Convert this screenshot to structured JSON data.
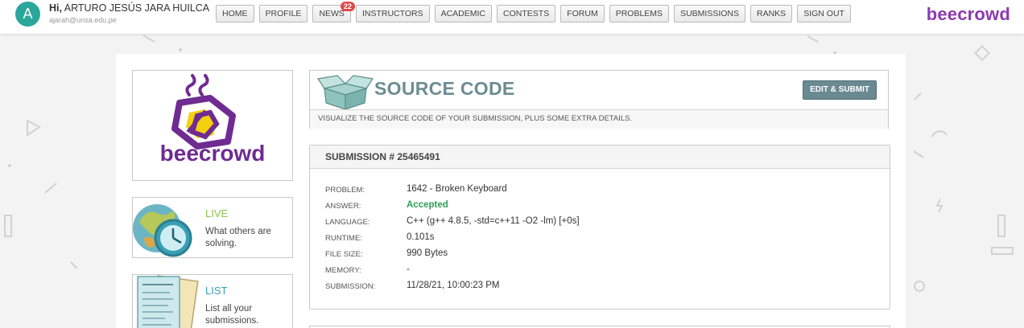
{
  "user": {
    "avatar_letter": "A",
    "greeting": "Hi,",
    "name": "ARTURO JESÚS JARA HUILCA",
    "email": "ajarah@unsa.edu.pe"
  },
  "nav": {
    "items": [
      {
        "label": "HOME"
      },
      {
        "label": "PROFILE"
      },
      {
        "label": "NEWS",
        "badge": "22"
      },
      {
        "label": "INSTRUCTORS"
      },
      {
        "label": "ACADEMIC"
      },
      {
        "label": "CONTESTS"
      },
      {
        "label": "FORUM"
      },
      {
        "label": "PROBLEMS"
      },
      {
        "label": "SUBMISSIONS"
      },
      {
        "label": "RANKS"
      },
      {
        "label": "SIGN OUT"
      }
    ]
  },
  "brand": {
    "name": "beecrowd",
    "color": "#8a3ab0",
    "logo_color": "#6f2b91"
  },
  "sidebar": {
    "live": {
      "title": "LIVE",
      "desc": "What others are solving.",
      "color": "#8bc34a"
    },
    "list": {
      "title": "LIST",
      "desc": "List all your submissions.",
      "color": "#3a9fb5"
    }
  },
  "header": {
    "title": "SOURCE CODE",
    "edit_button": "EDIT & SUBMIT",
    "subtitle": "VISUALIZE THE SOURCE CODE OF YOUR SUBMISSION, PLUS SOME EXTRA DETAILS."
  },
  "submission": {
    "heading": "SUBMISSION # 25465491",
    "details": [
      {
        "label": "PROBLEM:",
        "value": "1642 - Broken Keyboard"
      },
      {
        "label": "ANSWER:",
        "value": "Accepted",
        "status": "accepted"
      },
      {
        "label": "LANGUAGE:",
        "value": "C++ (g++ 4.8.5, -std=c++11 -O2 -lm) [+0s]"
      },
      {
        "label": "RUNTIME:",
        "value": "0.101s"
      },
      {
        "label": "FILE SIZE:",
        "value": "990 Bytes"
      },
      {
        "label": "MEMORY:",
        "value": "-"
      },
      {
        "label": "SUBMISSION:",
        "value": "11/28/21, 10:00:23 PM"
      }
    ]
  },
  "colors": {
    "accepted": "#2e9f53",
    "header_title": "#6c8d92",
    "edit_button_bg": "#6a8a92",
    "avatar_bg": "#2aa79b"
  }
}
